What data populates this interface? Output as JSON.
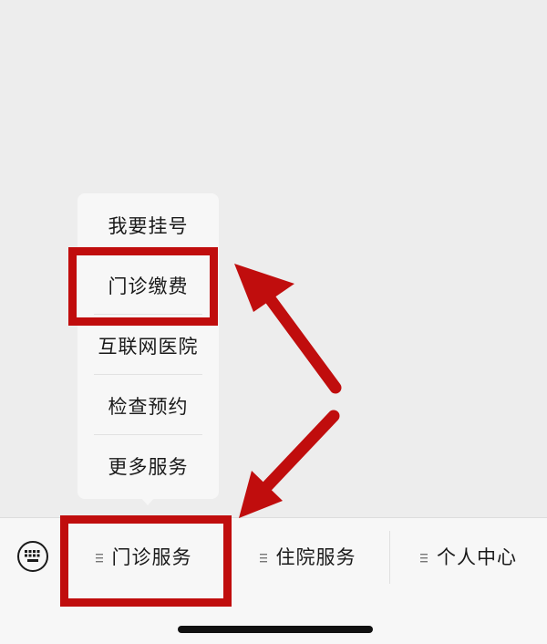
{
  "popup_menu": {
    "items": [
      {
        "label": "我要挂号"
      },
      {
        "label": "门诊缴费"
      },
      {
        "label": "互联网医院"
      },
      {
        "label": "检查预约"
      },
      {
        "label": "更多服务"
      }
    ]
  },
  "bottom_menu": {
    "tabs": [
      {
        "label": "门诊服务"
      },
      {
        "label": "住院服务"
      },
      {
        "label": "个人中心"
      }
    ]
  },
  "icons": {
    "keyboard": "keyboard-icon",
    "menu_lines": "menu-lines-icon",
    "arrow": "arrow-icon"
  },
  "colors": {
    "annotation": "#c00d0d",
    "background": "#ededed",
    "bar": "#f7f7f7"
  }
}
